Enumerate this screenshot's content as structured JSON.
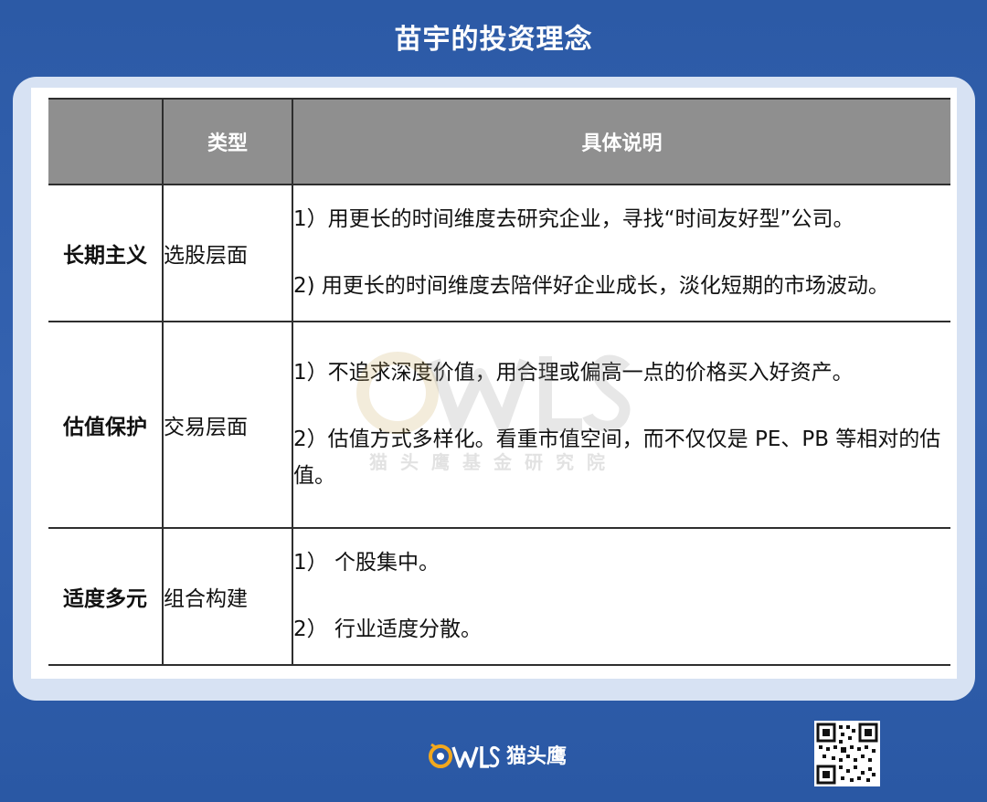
{
  "page": {
    "title": "苗宇的投资理念"
  },
  "table": {
    "headers": [
      "",
      "类型",
      "具体说明"
    ],
    "rows": [
      {
        "name": "长期主义",
        "type": "选股层面",
        "points": [
          "1）用更长的时间维度去研究企业，寻找“时间友好型”公司。",
          "2) 用更长的时间维度去陪伴好企业成长，淡化短期的市场波动。"
        ]
      },
      {
        "name": "估值保护",
        "type": "交易层面",
        "points": [
          "1）不追求深度价值，用合理或偏高一点的价格买入好资产。",
          "2）估值方式多样化。看重市值空间，而不仅仅是 PE、PB 等相对的估值。"
        ]
      },
      {
        "name": "适度多元",
        "type": "组合构建",
        "points": [
          "1） 个股集中。",
          "2） 行业适度分散。"
        ]
      }
    ]
  },
  "watermark": {
    "text": "猫头鹰基金研究院"
  },
  "footer": {
    "brand": "猫头鹰"
  },
  "colors": {
    "background": "#2f5eab",
    "card": "#d7e2f3",
    "header_fill": "#8f8f8f",
    "logo_accent": "#f2a81d"
  },
  "icons": {
    "logo": "owls-logo-icon",
    "qr": "qr-code-icon"
  }
}
